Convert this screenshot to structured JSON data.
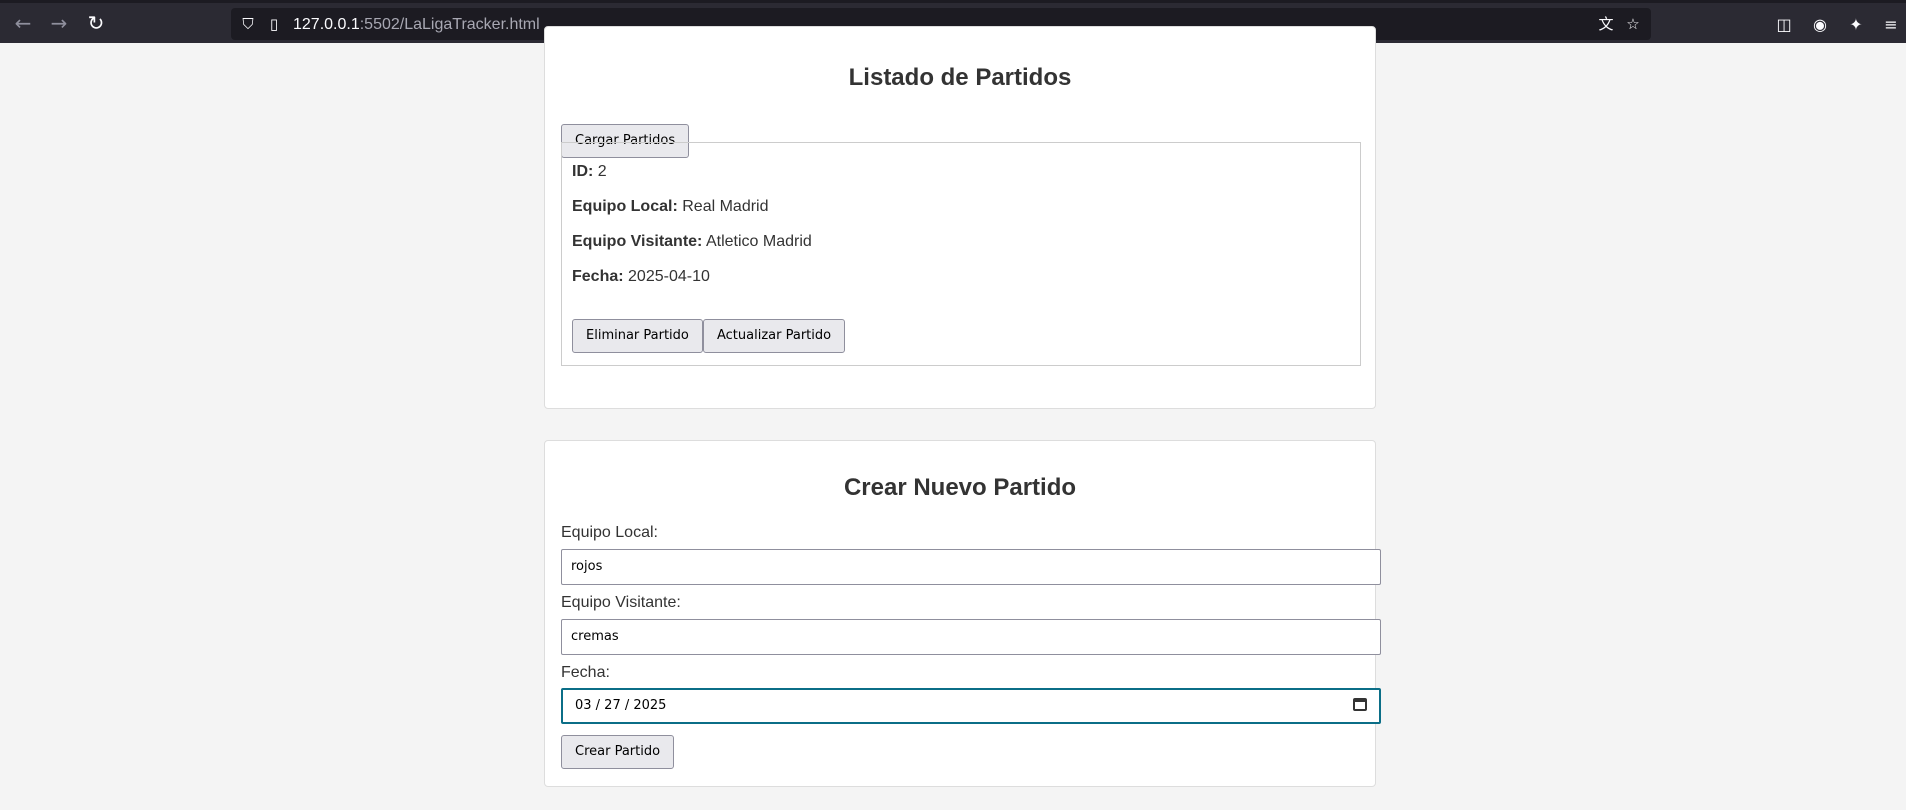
{
  "browser": {
    "url_host": "127.0.0.1",
    "url_path": ":5502/LaLigaTracker.html"
  },
  "list_section": {
    "title": "Listado de Partidos",
    "load_button": "Cargar Partidos",
    "match": {
      "id_label": "ID:",
      "id_value": "2",
      "home_label": "Equipo Local:",
      "home_value": "Real Madrid",
      "away_label": "Equipo Visitante:",
      "away_value": "Atletico Madrid",
      "date_label": "Fecha:",
      "date_value": "2025-04-10",
      "delete_button": "Eliminar Partido",
      "update_button": "Actualizar Partido"
    }
  },
  "create_section": {
    "title": "Crear Nuevo Partido",
    "home_label": "Equipo Local:",
    "home_value": "rojos",
    "away_label": "Equipo Visitante:",
    "away_value": "cremas",
    "date_label": "Fecha:",
    "date_value": "03 / 27 / 2025",
    "create_button": "Crear Partido"
  }
}
